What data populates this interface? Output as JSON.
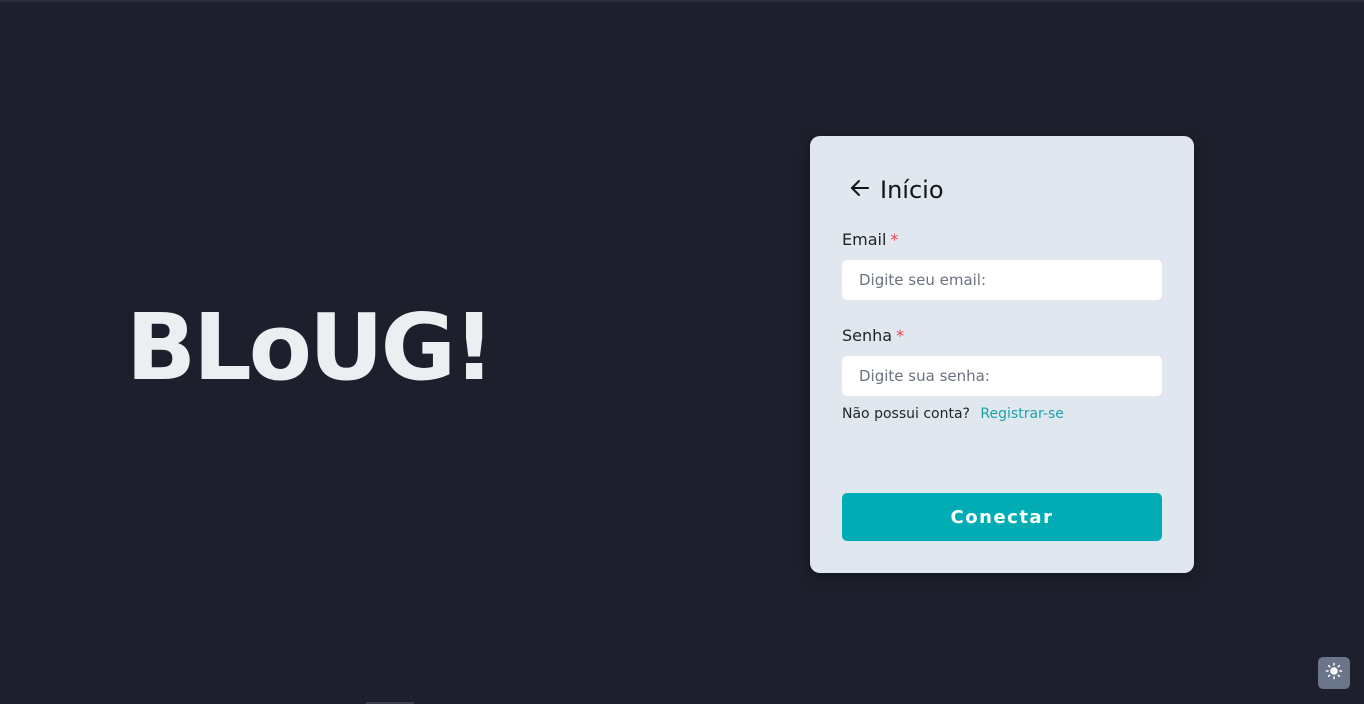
{
  "brand": {
    "title": "BLoUG!"
  },
  "card": {
    "back_label": "Início",
    "email": {
      "label": "Email",
      "required_mark": "*",
      "placeholder": "Digite seu email:"
    },
    "password": {
      "label": "Senha",
      "required_mark": "*",
      "placeholder": "Digite sua senha:"
    },
    "register": {
      "prompt": "Não possui conta?",
      "link": "Registrar-se"
    },
    "submit_label": "Conectar"
  },
  "theme_toggle": {
    "icon": "sun-icon"
  },
  "colors": {
    "background": "#1d202c",
    "card": "#e1e7ef",
    "accent": "#00adb5",
    "link": "#1aa3a8",
    "required": "#e5484d"
  }
}
